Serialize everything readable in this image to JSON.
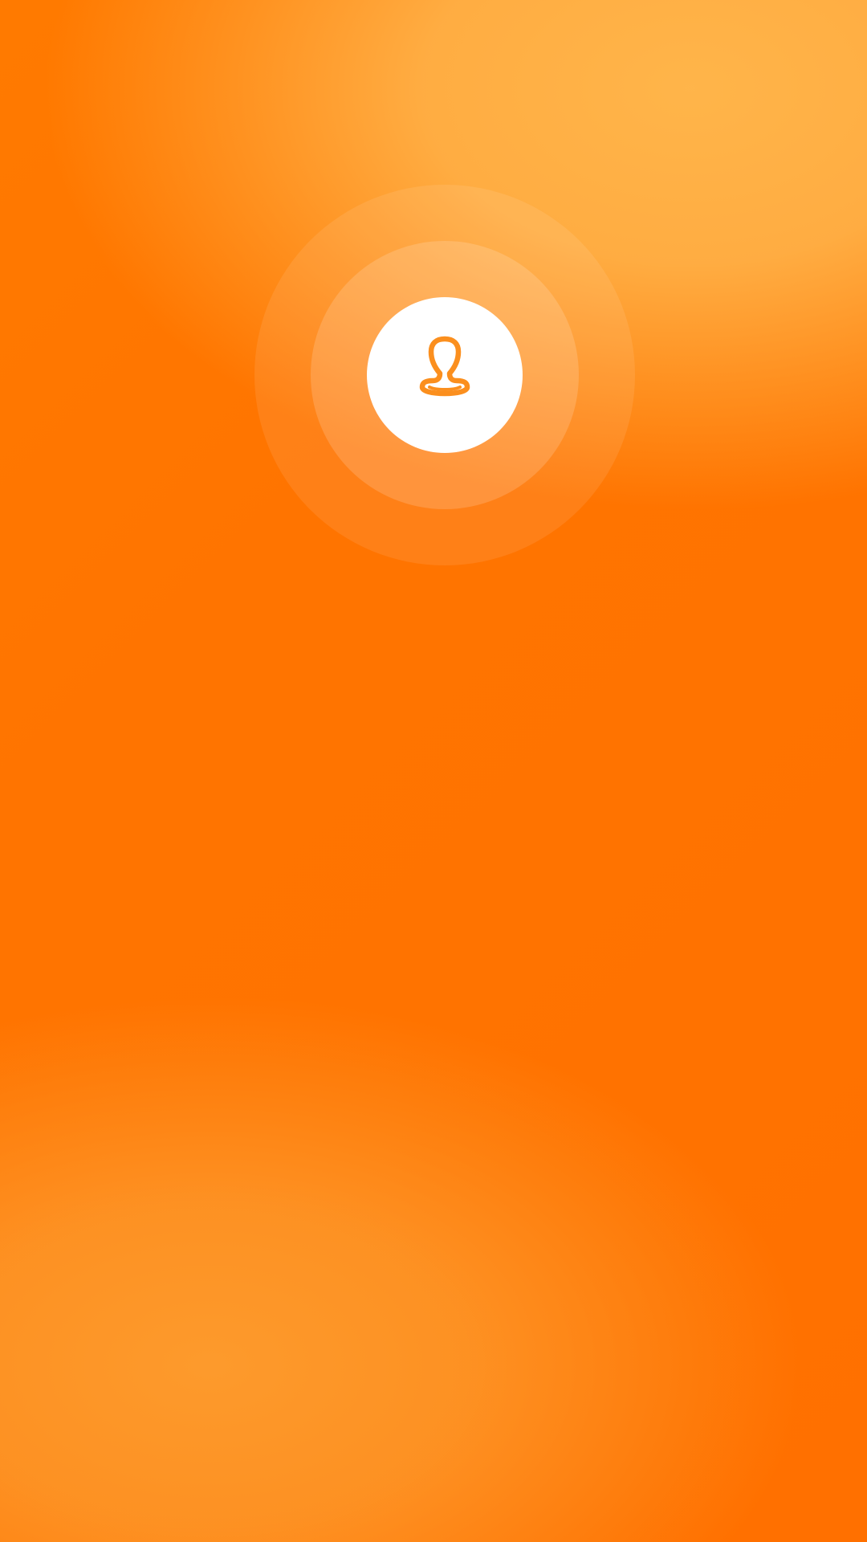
{
  "screen": {
    "background_colors": {
      "primary": "#ff7400",
      "highlight_top": "#ffb44b",
      "highlight_bottom": "#fd9b2d"
    }
  },
  "profile": {
    "icon": "person-outline-icon",
    "icon_color": "#fb8f1e",
    "badge_color": "#ffffff"
  }
}
